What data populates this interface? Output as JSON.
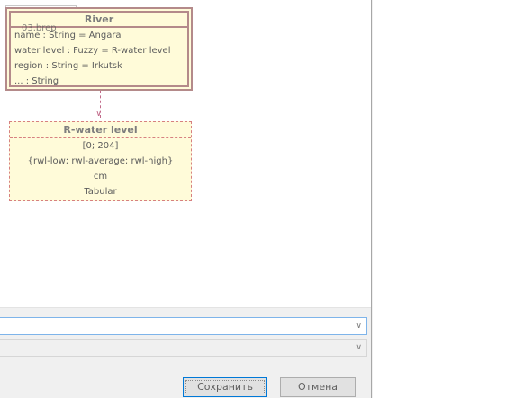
{
  "diagram": {
    "tooltip_label": "03.brep",
    "river_class": {
      "title": "River",
      "attributes": [
        "name : String = Angara",
        "water level : Fuzzy = R-water level",
        "region : String = Irkutsk",
        "... : String"
      ]
    },
    "water_level_type": {
      "title": "R-water level",
      "lines": [
        "[0; 204]",
        "{rwl-low; rwl-average; rwl-high}",
        "cm",
        "Tabular"
      ]
    }
  },
  "form": {
    "combo1_value": "",
    "combo2_value": ""
  },
  "buttons": {
    "save_label": "Сохранить",
    "cancel_label": "Отмена"
  },
  "icons": {
    "dropdown": "chevron-down-icon",
    "arrow": "open-arrow-head"
  },
  "colors": {
    "class_fill": "#fffbd9",
    "class_border": "#b48a8a",
    "dependency": "#c16a8a",
    "focus_border": "#0078d7"
  }
}
